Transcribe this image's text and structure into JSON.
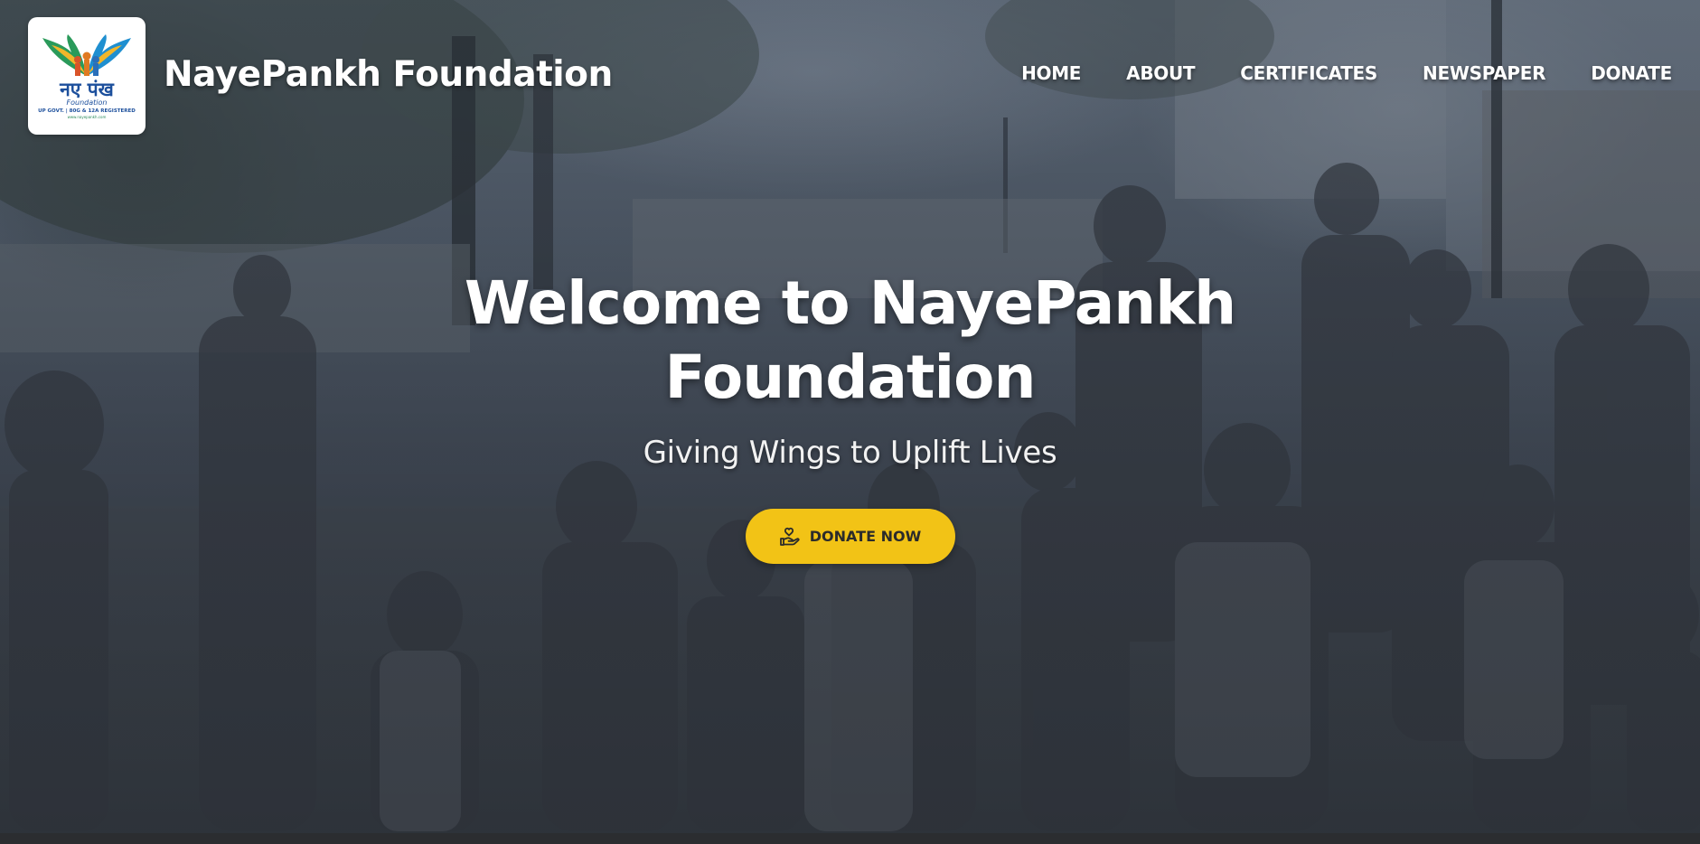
{
  "logo": {
    "hindi_text": "नए पंख",
    "script_text": "Foundation",
    "registration": "UP GOVT. | 80G & 12A REGISTERED",
    "website": "www.nayepankh.com"
  },
  "brand": {
    "name": "NayePankh Foundation"
  },
  "nav": {
    "items": [
      {
        "label": "HOME"
      },
      {
        "label": "ABOUT"
      },
      {
        "label": "CERTIFICATES"
      },
      {
        "label": "NEWSPAPER"
      },
      {
        "label": "DONATE"
      }
    ]
  },
  "hero": {
    "title": "Welcome to NayePankh Foundation",
    "subtitle": "Giving Wings to Uplift Lives",
    "cta_label": "DONATE NOW",
    "cta_icon": "hand-heart-icon"
  },
  "colors": {
    "accent": "#f2c316",
    "text_on_hero": "#ffffff",
    "logo_blue": "#1c4f9c"
  }
}
